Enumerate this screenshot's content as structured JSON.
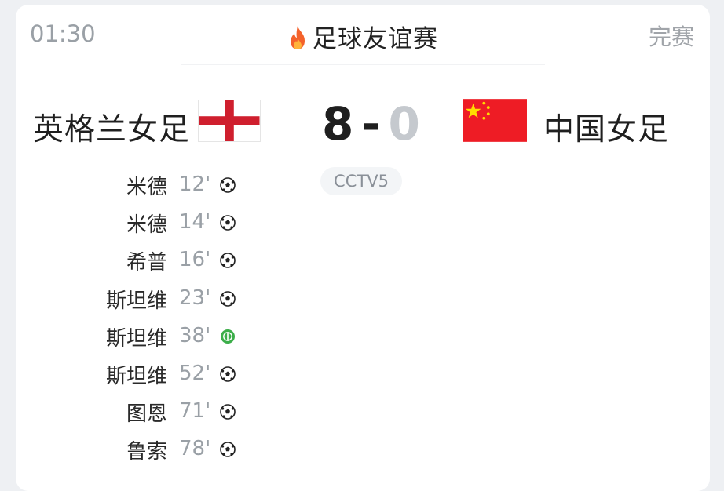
{
  "header": {
    "time": "01:30",
    "title": "足球友谊赛",
    "status": "完赛",
    "title_icon": "fire-icon"
  },
  "match": {
    "home_team": "英格兰女足",
    "away_team": "中国女足",
    "home_score": "8",
    "score_separator": "-",
    "away_score": "0",
    "channel": "CCTV5"
  },
  "goals": [
    {
      "scorer": "米德",
      "minute": "12'",
      "type": "goal"
    },
    {
      "scorer": "米德",
      "minute": "14'",
      "type": "goal"
    },
    {
      "scorer": "希普",
      "minute": "16'",
      "type": "goal"
    },
    {
      "scorer": "斯坦维",
      "minute": "23'",
      "type": "goal"
    },
    {
      "scorer": "斯坦维",
      "minute": "38'",
      "type": "penalty"
    },
    {
      "scorer": "斯坦维",
      "minute": "52'",
      "type": "goal"
    },
    {
      "scorer": "图恩",
      "minute": "71'",
      "type": "goal"
    },
    {
      "scorer": "鲁索",
      "minute": "78'",
      "type": "goal"
    }
  ],
  "colors": {
    "england_red": "#cf1f2e",
    "china_red": "#ee1c25",
    "china_star": "#ffde00",
    "penalty_green": "#3cae4a",
    "muted": "#9aa0a6"
  }
}
